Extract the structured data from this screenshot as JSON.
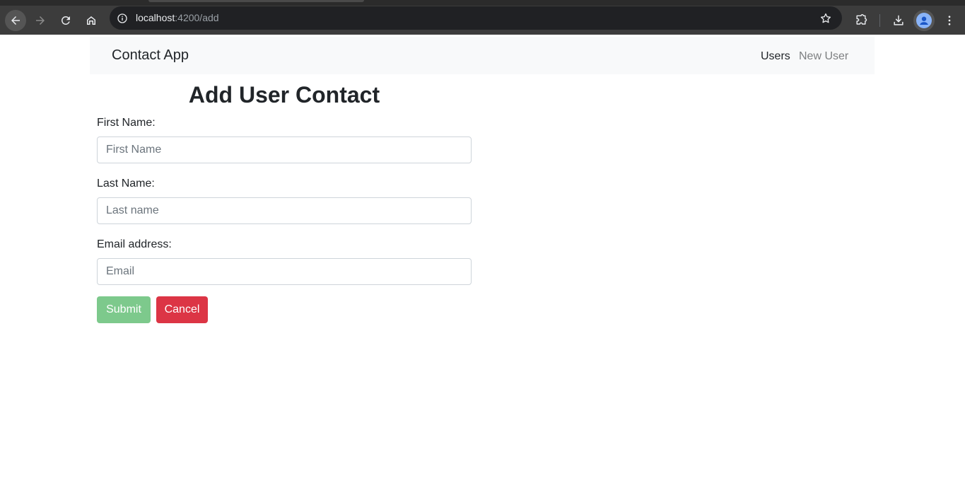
{
  "browser": {
    "url_host": "localhost",
    "url_path": ":4200/add",
    "icons": {
      "back": "arrow-left-icon",
      "forward": "arrow-right-icon",
      "reload": "reload-icon",
      "home": "home-icon",
      "site_info": "info-icon",
      "bookmark": "star-icon",
      "extensions": "puzzle-icon",
      "downloads": "download-icon",
      "profile": "profile-icon",
      "menu": "kebab-menu-icon"
    }
  },
  "navbar": {
    "brand": "Contact App",
    "links": [
      {
        "label": "Users"
      },
      {
        "label": "New User"
      }
    ]
  },
  "form": {
    "title": "Add User Contact",
    "first_name": {
      "label": "First Name:",
      "placeholder": "First Name",
      "value": ""
    },
    "last_name": {
      "label": "Last Name:",
      "placeholder": "Last name",
      "value": ""
    },
    "email": {
      "label": "Email address:",
      "placeholder": "Email",
      "value": ""
    },
    "submit_label": "Submit",
    "cancel_label": "Cancel"
  },
  "colors": {
    "submit_button": "#7dc98c",
    "cancel_button": "#dc3545",
    "navbar_bg": "#f8f9fa",
    "inactive_link": "#7d7f81"
  }
}
